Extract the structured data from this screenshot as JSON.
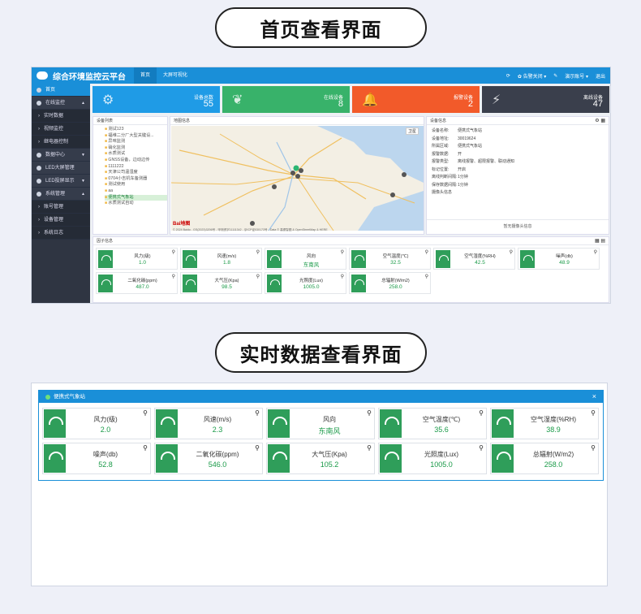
{
  "heading1": "首页查看界面",
  "heading2": "实时数据查看界面",
  "app": {
    "title": "综合环境监控云平台",
    "nav": [
      "首页",
      "大屏可视化"
    ],
    "right": [
      "✿ 告警关闭 ▾",
      "演示账号 ▾",
      "退出"
    ]
  },
  "sidebar": [
    {
      "label": "首页",
      "type": "active"
    },
    {
      "label": "在线监控",
      "type": "head",
      "caret": "▲"
    },
    {
      "label": "实时数据",
      "type": "sub"
    },
    {
      "label": "视频监控",
      "type": "sub"
    },
    {
      "label": "继电器控制",
      "type": "sub"
    },
    {
      "label": "数据中心",
      "type": "head",
      "caret": "▼"
    },
    {
      "label": "LED大屏管理",
      "type": "head"
    },
    {
      "label": "LED投屏显示",
      "type": "head",
      "caret": "▼"
    },
    {
      "label": "系统管理",
      "type": "head",
      "caret": "▲"
    },
    {
      "label": "账号管理",
      "type": "sub"
    },
    {
      "label": "设备管理",
      "type": "sub"
    },
    {
      "label": "系统日志",
      "type": "sub"
    }
  ],
  "cards": [
    {
      "label": "设备总数",
      "value": "55",
      "color": "#1f9be6",
      "icon": "⚙"
    },
    {
      "label": "在线设备",
      "value": "8",
      "color": "#38b26a",
      "icon": "❦"
    },
    {
      "label": "报警设备",
      "value": "2",
      "color": "#f25a2a",
      "icon": "🔔"
    },
    {
      "label": "离线设备",
      "value": "47",
      "color": "#3a3f4c",
      "icon": "⚡"
    }
  ],
  "panels": {
    "devices": "设备列表",
    "map": "地图信息",
    "info": "设备信息",
    "factors": "因子信息"
  },
  "tree": [
    "测试123",
    "福维二分厂大型关键设...",
    "异味监测",
    "硝化监测",
    "水质测试",
    "GNSS设备，边动边传",
    "1111222",
    "天津公司温湿度",
    "0704小吉机车备测器",
    "测试使用",
    "aa",
    "便携式气象站",
    "水质测试自动"
  ],
  "map": {
    "footer": "© 2024 Baidu - GS(2023)3206号 - 甲测资字11111342 - 京ICP证030173号 - Data © 高德智图 & OpenStreetMap & HERE",
    "tab": "卫星"
  },
  "device_info": [
    {
      "k": "设备名称:",
      "v": "便携式气象站"
    },
    {
      "k": "设备地址:",
      "v": "30019624"
    },
    {
      "k": "所属区域:",
      "v": "便携式气象站"
    },
    {
      "k": "报警数据:",
      "v": "开"
    },
    {
      "k": "报警类型:",
      "v": "离线报警、超限报警、联动通知"
    },
    {
      "k": "标记位置:",
      "v": "开启"
    },
    {
      "k": "离线判断间隔:",
      "v": "1分钟"
    },
    {
      "k": "保存数据间隔:",
      "v": "1分钟"
    },
    {
      "k": "摄像头信息",
      "v": ""
    }
  ],
  "no_camera": "暂无摄像头信息",
  "factors": [
    {
      "label": "风力(级)",
      "value": "1.0"
    },
    {
      "label": "风速(m/s)",
      "value": "1.8"
    },
    {
      "label": "风向",
      "value": "东南风"
    },
    {
      "label": "空气温度(℃)",
      "value": "32.5"
    },
    {
      "label": "空气湿度(%RH)",
      "value": "42.5"
    },
    {
      "label": "噪声(db)",
      "value": "48.9"
    },
    {
      "label": "二氧化碳(ppm)",
      "value": "487.0"
    },
    {
      "label": "大气压(Kpa)",
      "value": "98.5"
    },
    {
      "label": "光照度(Lux)",
      "value": "1005.0"
    },
    {
      "label": "总辐射(W/m2)",
      "value": "258.0"
    }
  ],
  "dialog": {
    "title": "便携式气象站",
    "close": "×",
    "items": [
      {
        "label": "风力(级)",
        "value": "2.0"
      },
      {
        "label": "风速(m/s)",
        "value": "2.3"
      },
      {
        "label": "风向",
        "value": "东南风"
      },
      {
        "label": "空气温度(℃)",
        "value": "35.6"
      },
      {
        "label": "空气湿度(%RH)",
        "value": "38.9"
      },
      {
        "label": "噪声(db)",
        "value": "52.8"
      },
      {
        "label": "二氧化碳(ppm)",
        "value": "546.0"
      },
      {
        "label": "大气压(Kpa)",
        "value": "105.2"
      },
      {
        "label": "光照度(Lux)",
        "value": "1005.0"
      },
      {
        "label": "总辐射(W/m2)",
        "value": "258.0"
      }
    ]
  }
}
